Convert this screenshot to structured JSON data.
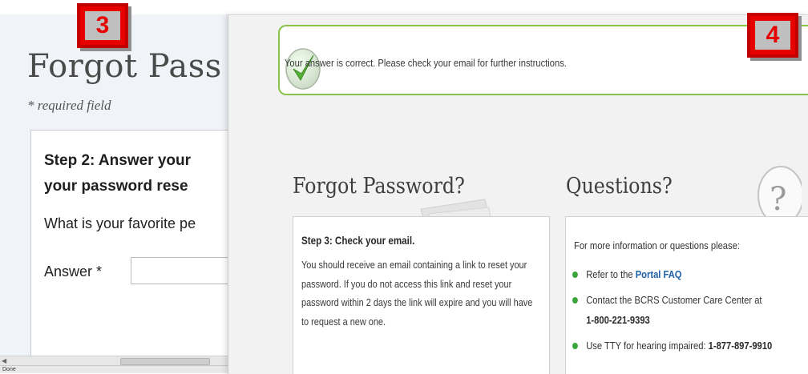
{
  "back_page": {
    "title": "Forgot Pass",
    "required_note": "* required field",
    "step_line1": "Step 2: Answer your",
    "step_line2": "your password rese",
    "question": "What is your favorite pe",
    "answer_label": "Answer *",
    "answer_value": "",
    "status_text": "Done"
  },
  "front_page": {
    "success_message": "Your answer is correct. Please check your email for further instructions.",
    "forgot_heading": "Forgot Password?",
    "questions_heading": "Questions?",
    "step3_title": "Step 3: Check your email.",
    "step3_lines": [
      "You should receive an email containing a link to reset your",
      "password. If you do not access this link and reset your",
      "password within 2 days the link will expire and you will have",
      "to request a new one."
    ],
    "questions_intro": "For more information or questions please:",
    "refer_prefix": "Refer to the ",
    "refer_link": "Portal FAQ",
    "contact_text": "Contact the BCRS Customer Care Center at",
    "contact_phone": "1-800-221-9393",
    "tty_prefix": "Use TTY for hearing impaired: ",
    "tty_phone": "1-877-897-9910"
  },
  "badges": {
    "left": "3",
    "right": "4"
  },
  "colors": {
    "badge_red": "#e60000",
    "success_green": "#8bc34a",
    "link_blue": "#1f5fa8",
    "bullet_green": "#3aa53a"
  }
}
